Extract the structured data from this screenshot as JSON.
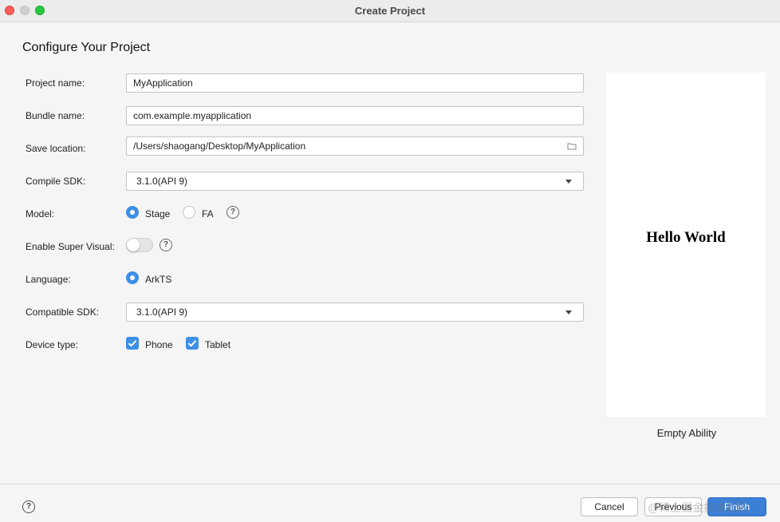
{
  "window": {
    "title": "Create Project"
  },
  "page": {
    "heading": "Configure Your Project"
  },
  "form": {
    "project_name": {
      "label": "Project name:",
      "value": "MyApplication"
    },
    "bundle_name": {
      "label": "Bundle name:",
      "value": "com.example.myapplication"
    },
    "save_location": {
      "label": "Save location:",
      "value": "/Users/shaogang/Desktop/MyApplication"
    },
    "compile_sdk": {
      "label": "Compile SDK:",
      "value": "3.1.0(API 9)"
    },
    "model": {
      "label": "Model:",
      "options": [
        "Stage",
        "FA"
      ],
      "selected": "Stage",
      "help": "?"
    },
    "super_visual": {
      "label": "Enable Super Visual:",
      "enabled": false,
      "help": "?"
    },
    "language": {
      "label": "Language:",
      "option": "ArkTS",
      "selected": "ArkTS"
    },
    "compatible_sdk": {
      "label": "Compatible SDK:",
      "value": "3.1.0(API 9)"
    },
    "device_type": {
      "label": "Device type:",
      "options": [
        "Phone",
        "Tablet"
      ],
      "checked": [
        "Phone",
        "Tablet"
      ]
    }
  },
  "preview": {
    "text": "Hello World",
    "template_name": "Empty Ability"
  },
  "footer": {
    "help": "?",
    "cancel_label": "Cancel",
    "previous_label": "Previous",
    "finish_label": "Finish",
    "watermark": "@稀土掘金技术社区"
  },
  "colors": {
    "accent": "#3d8fe6",
    "finish_button": "#3b7fd6",
    "background": "#f5f5f5"
  }
}
